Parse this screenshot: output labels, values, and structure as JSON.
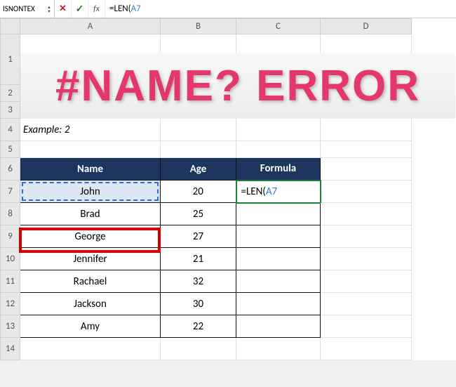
{
  "formula_bar": {
    "name_box": "ISNONTEX",
    "cancel_glyph": "✕",
    "enter_glyph": "✓",
    "fx_glyph": "fx",
    "prefix": "=LEN(",
    "ref": "A7"
  },
  "columns": [
    "A",
    "B",
    "C",
    "D"
  ],
  "rows": [
    "1",
    "2",
    "3",
    "4",
    "5",
    "6",
    "7",
    "8",
    "9",
    "10",
    "11",
    "12",
    "13",
    "14"
  ],
  "banner": "#NAME? ERROR",
  "example_label": "Example: 2",
  "table": {
    "headers": {
      "name": "Name",
      "age": "Age",
      "formula": "Formula"
    },
    "rows": [
      {
        "name": "John",
        "age": "20",
        "formula_prefix": "=LEN(",
        "formula_ref": "A7"
      },
      {
        "name": "Brad",
        "age": "25",
        "formula_prefix": "",
        "formula_ref": ""
      },
      {
        "name": "George",
        "age": "27",
        "formula_prefix": "",
        "formula_ref": ""
      },
      {
        "name": "Jennifer",
        "age": "21",
        "formula_prefix": "",
        "formula_ref": ""
      },
      {
        "name": "Rachael",
        "age": "32",
        "formula_prefix": "",
        "formula_ref": ""
      },
      {
        "name": "Jackson",
        "age": "30",
        "formula_prefix": "",
        "formula_ref": ""
      },
      {
        "name": "Amy",
        "age": "22",
        "formula_prefix": "",
        "formula_ref": ""
      }
    ]
  }
}
